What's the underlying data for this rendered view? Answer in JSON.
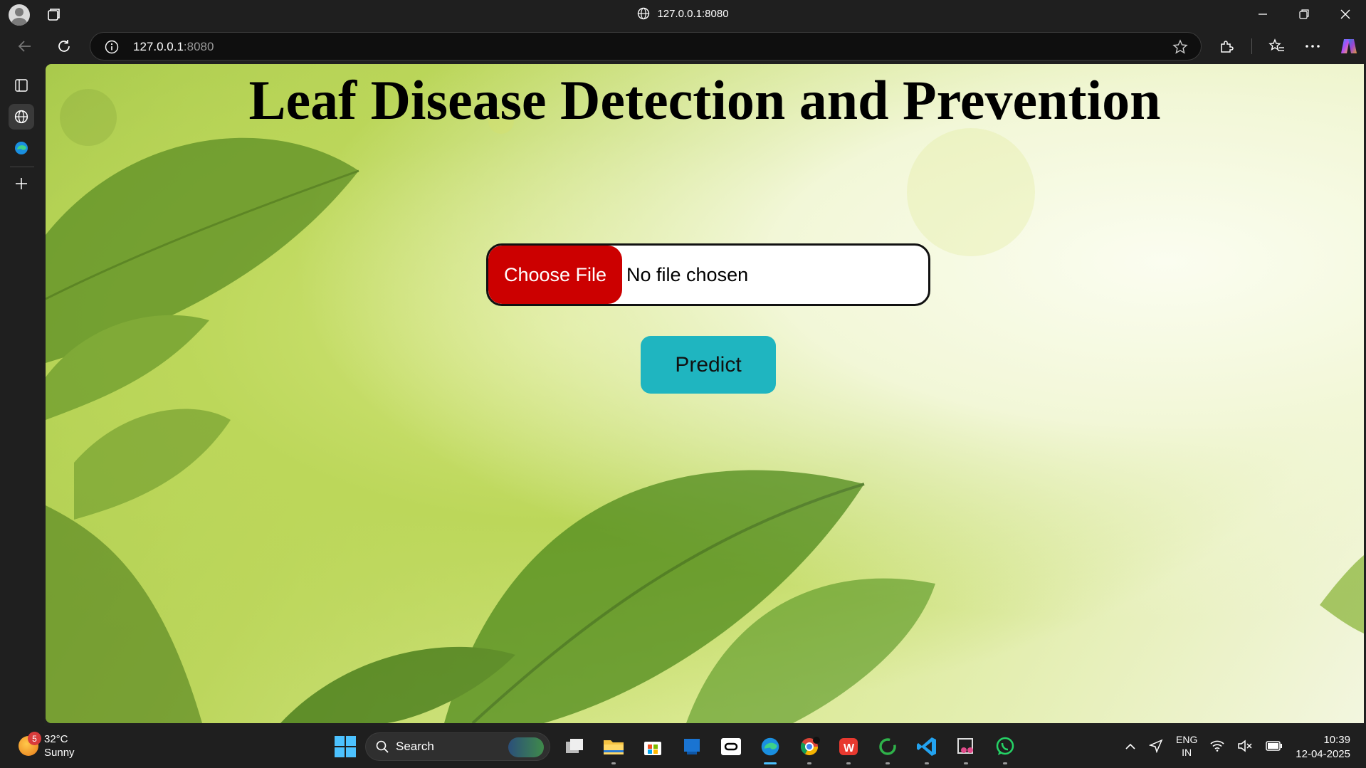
{
  "browser": {
    "window_title": "127.0.0.1:8080",
    "url_host": "127.0.0.1",
    "url_port": ":8080"
  },
  "page": {
    "title": "Leaf Disease Detection and Prevention",
    "file_input": {
      "button_label": "Choose File",
      "status_text": "No file chosen"
    },
    "predict_label": "Predict"
  },
  "colors": {
    "choose_file_bg": "#cc0000",
    "predict_bg": "#1fb5c0"
  },
  "taskbar": {
    "weather": {
      "temp": "32°C",
      "condition": "Sunny",
      "badge": "5"
    },
    "search_label": "Search",
    "lang_top": "ENG",
    "lang_bottom": "IN",
    "time": "10:39",
    "date": "12-04-2025",
    "apps": [
      "task-view",
      "file-explorer",
      "microsoft-store",
      "microsoft-todo",
      "oracle-app",
      "edge",
      "chrome",
      "wps-office",
      "loading-app",
      "vscode",
      "snipping-tool",
      "whatsapp"
    ]
  }
}
